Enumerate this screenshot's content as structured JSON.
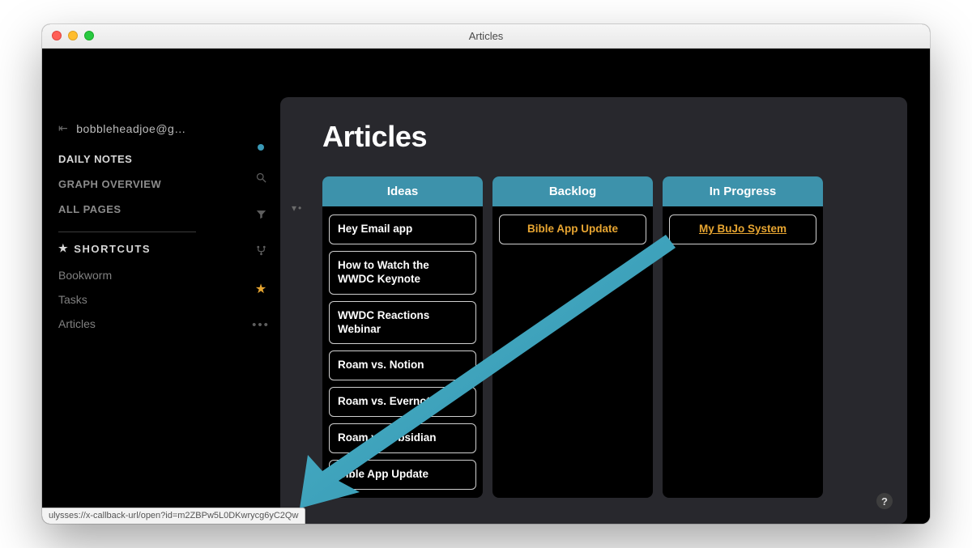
{
  "window": {
    "title": "Articles"
  },
  "sidebar": {
    "account_label": "bobbleheadjoe@g…",
    "nav": {
      "daily_notes": "DAILY NOTES",
      "graph_overview": "GRAPH OVERVIEW",
      "all_pages": "ALL PAGES"
    },
    "shortcuts_header": "SHORTCUTS",
    "shortcuts": {
      "bookworm": "Bookworm",
      "tasks": "Tasks",
      "articles": "Articles"
    }
  },
  "rail_icons": {
    "dot": "active-dot",
    "search": "search-icon",
    "filter": "filter-icon",
    "fork": "fork-icon",
    "star": "star-icon",
    "more": "more-icon"
  },
  "page": {
    "title": "Articles"
  },
  "board": {
    "columns": [
      {
        "header": "Ideas",
        "cards": [
          "Hey Email app",
          "How to Watch the WWDC Keynote",
          "WWDC Reactions Webinar",
          "Roam vs. Notion",
          "Roam vs. Evernote",
          "Roam vs. Obsidian",
          "Bible App Update"
        ],
        "link_style": "plain"
      },
      {
        "header": "Backlog",
        "cards": [
          "Bible App Update"
        ],
        "link_style": "link"
      },
      {
        "header": "In Progress",
        "cards": [
          "My BuJo System"
        ],
        "link_style": "link-underline"
      }
    ]
  },
  "help_label": "?",
  "status_url": "ulysses://x-callback-url/open?id=m2ZBPw5L0DKwrycg6yC2Qw",
  "colors": {
    "accent_teal": "#3d92ab",
    "link_amber": "#e7a531",
    "arrow": "#3ba8c4"
  }
}
